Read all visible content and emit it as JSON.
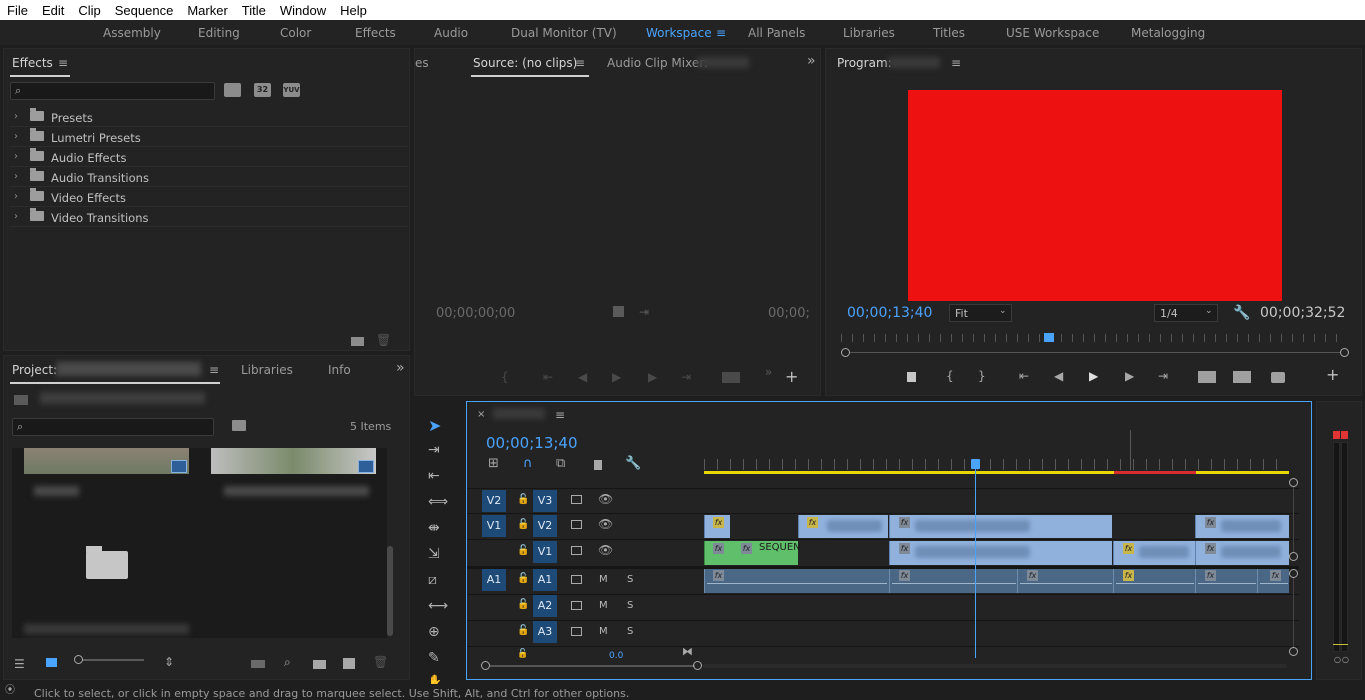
{
  "menu": [
    "File",
    "Edit",
    "Clip",
    "Sequence",
    "Marker",
    "Title",
    "Window",
    "Help"
  ],
  "workspaces": {
    "items": [
      "Assembly",
      "Editing",
      "Color",
      "Effects",
      "Audio",
      "Dual Monitor (TV)",
      "Workspace",
      "All Panels",
      "Libraries",
      "Titles",
      "USE Workspace",
      "Metalogging"
    ],
    "active": "Workspace",
    "menu_icon": "≡"
  },
  "effects_panel": {
    "title": "Effects",
    "badges": [
      "32",
      "YUV"
    ],
    "tree": [
      "Presets",
      "Lumetri Presets",
      "Audio Effects",
      "Audio Transitions",
      "Video Effects",
      "Video Transitions"
    ]
  },
  "project_panel": {
    "tabs": [
      "Project:",
      "Libraries",
      "Info"
    ],
    "item_count": "5 Items"
  },
  "source_panel": {
    "tab_cut": "es",
    "title": "Source: (no clips)",
    "tab2": "Audio Clip Mixer:",
    "tc_left": "00;00;00;00",
    "tc_right": "00;00;"
  },
  "program_panel": {
    "title": "Program:",
    "tc_current": "00;00;13;40",
    "fit": "Fit",
    "quality": "1/4",
    "tc_duration": "00;00;32;52",
    "frame_color": "#ed1111"
  },
  "timeline": {
    "timecode": "00;00;13;40",
    "tracks": {
      "v3": [
        "V2",
        "V3"
      ],
      "v2": [
        "V1",
        "V2"
      ],
      "v1": "V1",
      "a1": [
        "A1",
        "A1"
      ],
      "a2": "A2",
      "a3": "A3",
      "mute": "M",
      "solo": "S"
    },
    "green_clip_label": "SEQUEN",
    "vol": "0.0"
  },
  "status_bar": "Click to select, or click in empty space and drag to marquee select. Use Shift, Alt, and Ctrl for other options.",
  "colors": {
    "accent": "#4aa3ff",
    "track_blue": "#1e4a77",
    "clip_blue": "#8fb1dc",
    "clip_green": "#5fbf6a",
    "audio": "#4a6786",
    "fx": "#c9b64a"
  }
}
